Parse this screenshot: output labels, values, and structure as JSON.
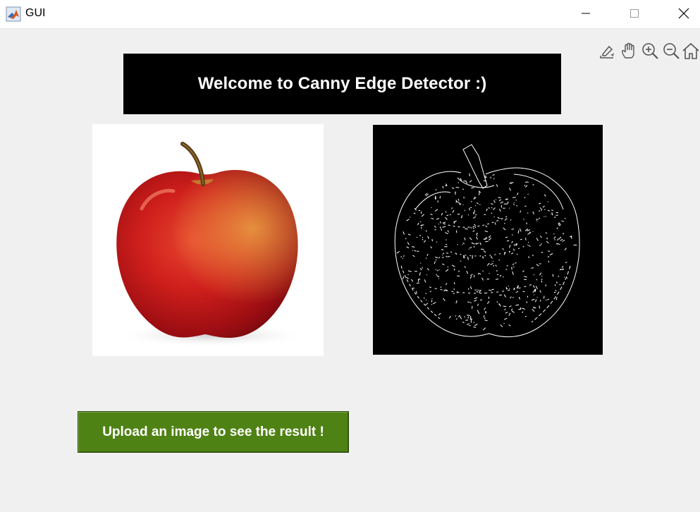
{
  "window": {
    "title": "GUI"
  },
  "toolbar": {
    "icons": [
      "brush-icon",
      "pan-hand-icon",
      "zoom-in-icon",
      "zoom-out-icon",
      "home-icon"
    ]
  },
  "banner": {
    "text": "Welcome to Canny Edge Detector :)"
  },
  "images": {
    "original": "apple-photo",
    "edges": "canny-edge-result"
  },
  "upload_button": {
    "label": "Upload an image to see the result !"
  },
  "colors": {
    "banner_bg": "#000000",
    "button_bg": "#4f8214",
    "window_bg": "#f0f0f0"
  }
}
